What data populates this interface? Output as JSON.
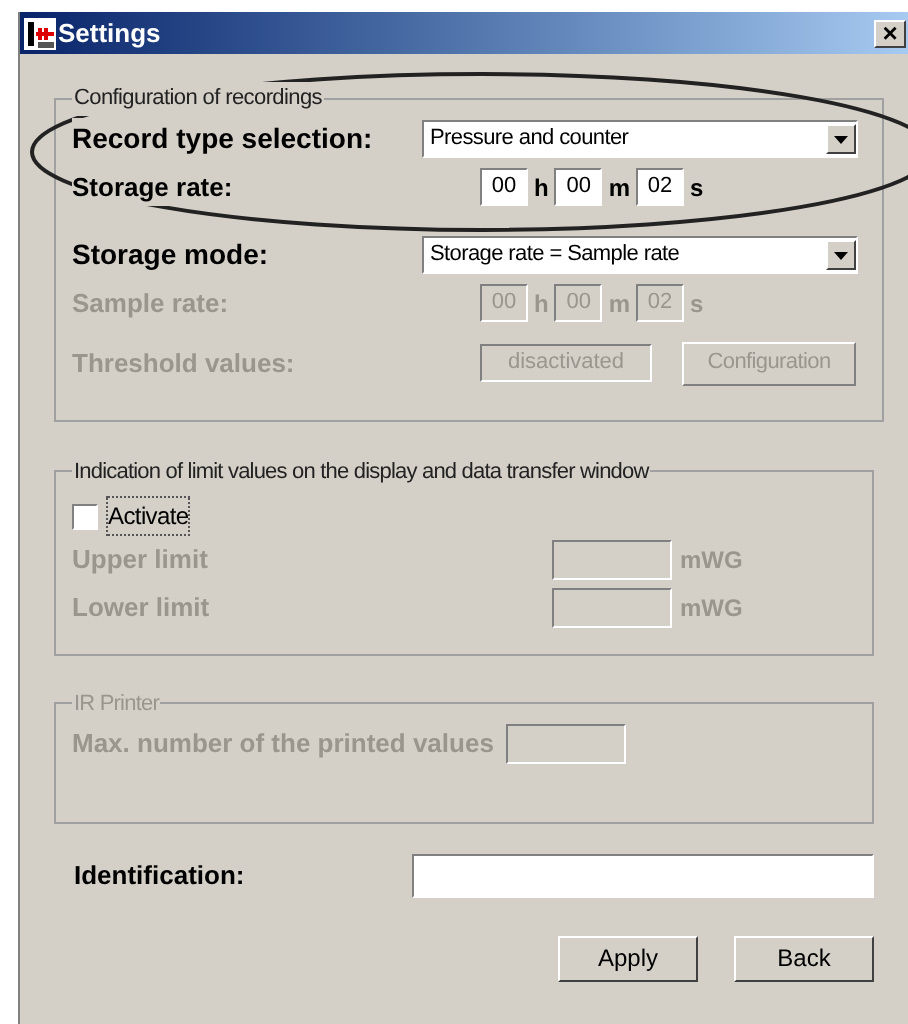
{
  "window": {
    "title": "Settings",
    "close": "×"
  },
  "recording": {
    "title": "Configuration of recordings",
    "rows": [
      {
        "kind": "dropdown",
        "label": "Record type selection:",
        "value": "Pressure and counter",
        "disabled": false
      },
      {
        "kind": "time",
        "label": "Storage rate:",
        "disabled": false,
        "parts": [
          {
            "value": "00",
            "unit": "h"
          },
          {
            "value": "00",
            "unit": "m"
          },
          {
            "value": "02",
            "unit": "s"
          }
        ]
      },
      {
        "kind": "dropdown",
        "label": "Storage mode:",
        "value": "Storage rate = Sample rate",
        "disabled": false
      },
      {
        "kind": "time",
        "label": "Sample rate:",
        "disabled": true,
        "parts": [
          {
            "value": "00",
            "unit": "h"
          },
          {
            "value": "00",
            "unit": "m"
          },
          {
            "value": "02",
            "unit": "s"
          }
        ]
      },
      {
        "kind": "threshold",
        "label": "Threshold values:",
        "disabled": true,
        "status": "disactivated",
        "button": "Configuration"
      }
    ]
  },
  "limits": {
    "title": "Indication of limit values on the display and data transfer window",
    "activate": {
      "label": "Activate",
      "checked": false
    },
    "rows": [
      {
        "label": "Upper limit",
        "unit": "mWG",
        "disabled": true
      },
      {
        "label": "Lower limit",
        "unit": "mWG",
        "disabled": true
      }
    ]
  },
  "printer": {
    "title": "IR Printer",
    "disabled": true,
    "label": "Max. number of the printed values"
  },
  "identification": {
    "label": "Identification:"
  },
  "buttons": [
    "Apply",
    "Back"
  ]
}
